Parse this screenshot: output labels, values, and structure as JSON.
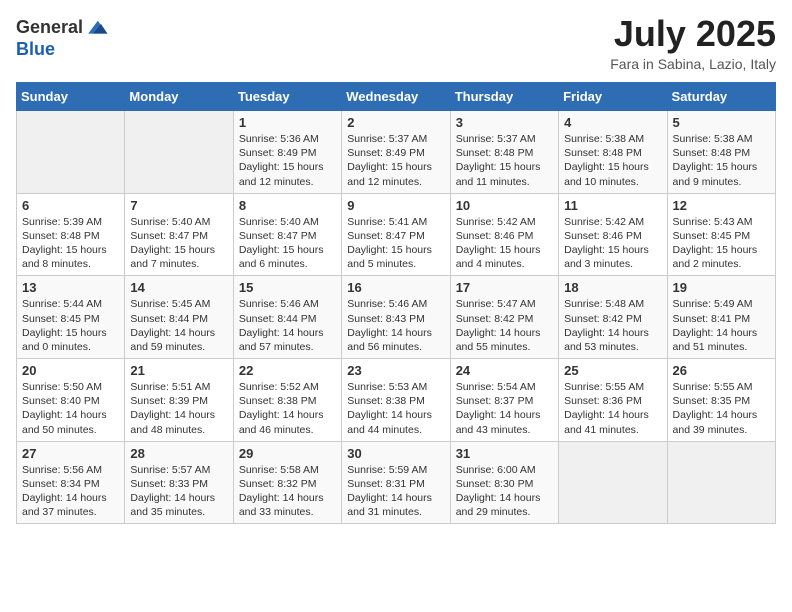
{
  "logo": {
    "general": "General",
    "blue": "Blue"
  },
  "title": "July 2025",
  "subtitle": "Fara in Sabina, Lazio, Italy",
  "days_of_week": [
    "Sunday",
    "Monday",
    "Tuesday",
    "Wednesday",
    "Thursday",
    "Friday",
    "Saturday"
  ],
  "weeks": [
    [
      {
        "day": "",
        "empty": true
      },
      {
        "day": "",
        "empty": true
      },
      {
        "day": "1",
        "sunrise": "Sunrise: 5:36 AM",
        "sunset": "Sunset: 8:49 PM",
        "daylight": "Daylight: 15 hours and 12 minutes."
      },
      {
        "day": "2",
        "sunrise": "Sunrise: 5:37 AM",
        "sunset": "Sunset: 8:49 PM",
        "daylight": "Daylight: 15 hours and 12 minutes."
      },
      {
        "day": "3",
        "sunrise": "Sunrise: 5:37 AM",
        "sunset": "Sunset: 8:48 PM",
        "daylight": "Daylight: 15 hours and 11 minutes."
      },
      {
        "day": "4",
        "sunrise": "Sunrise: 5:38 AM",
        "sunset": "Sunset: 8:48 PM",
        "daylight": "Daylight: 15 hours and 10 minutes."
      },
      {
        "day": "5",
        "sunrise": "Sunrise: 5:38 AM",
        "sunset": "Sunset: 8:48 PM",
        "daylight": "Daylight: 15 hours and 9 minutes."
      }
    ],
    [
      {
        "day": "6",
        "sunrise": "Sunrise: 5:39 AM",
        "sunset": "Sunset: 8:48 PM",
        "daylight": "Daylight: 15 hours and 8 minutes."
      },
      {
        "day": "7",
        "sunrise": "Sunrise: 5:40 AM",
        "sunset": "Sunset: 8:47 PM",
        "daylight": "Daylight: 15 hours and 7 minutes."
      },
      {
        "day": "8",
        "sunrise": "Sunrise: 5:40 AM",
        "sunset": "Sunset: 8:47 PM",
        "daylight": "Daylight: 15 hours and 6 minutes."
      },
      {
        "day": "9",
        "sunrise": "Sunrise: 5:41 AM",
        "sunset": "Sunset: 8:47 PM",
        "daylight": "Daylight: 15 hours and 5 minutes."
      },
      {
        "day": "10",
        "sunrise": "Sunrise: 5:42 AM",
        "sunset": "Sunset: 8:46 PM",
        "daylight": "Daylight: 15 hours and 4 minutes."
      },
      {
        "day": "11",
        "sunrise": "Sunrise: 5:42 AM",
        "sunset": "Sunset: 8:46 PM",
        "daylight": "Daylight: 15 hours and 3 minutes."
      },
      {
        "day": "12",
        "sunrise": "Sunrise: 5:43 AM",
        "sunset": "Sunset: 8:45 PM",
        "daylight": "Daylight: 15 hours and 2 minutes."
      }
    ],
    [
      {
        "day": "13",
        "sunrise": "Sunrise: 5:44 AM",
        "sunset": "Sunset: 8:45 PM",
        "daylight": "Daylight: 15 hours and 0 minutes."
      },
      {
        "day": "14",
        "sunrise": "Sunrise: 5:45 AM",
        "sunset": "Sunset: 8:44 PM",
        "daylight": "Daylight: 14 hours and 59 minutes."
      },
      {
        "day": "15",
        "sunrise": "Sunrise: 5:46 AM",
        "sunset": "Sunset: 8:44 PM",
        "daylight": "Daylight: 14 hours and 57 minutes."
      },
      {
        "day": "16",
        "sunrise": "Sunrise: 5:46 AM",
        "sunset": "Sunset: 8:43 PM",
        "daylight": "Daylight: 14 hours and 56 minutes."
      },
      {
        "day": "17",
        "sunrise": "Sunrise: 5:47 AM",
        "sunset": "Sunset: 8:42 PM",
        "daylight": "Daylight: 14 hours and 55 minutes."
      },
      {
        "day": "18",
        "sunrise": "Sunrise: 5:48 AM",
        "sunset": "Sunset: 8:42 PM",
        "daylight": "Daylight: 14 hours and 53 minutes."
      },
      {
        "day": "19",
        "sunrise": "Sunrise: 5:49 AM",
        "sunset": "Sunset: 8:41 PM",
        "daylight": "Daylight: 14 hours and 51 minutes."
      }
    ],
    [
      {
        "day": "20",
        "sunrise": "Sunrise: 5:50 AM",
        "sunset": "Sunset: 8:40 PM",
        "daylight": "Daylight: 14 hours and 50 minutes."
      },
      {
        "day": "21",
        "sunrise": "Sunrise: 5:51 AM",
        "sunset": "Sunset: 8:39 PM",
        "daylight": "Daylight: 14 hours and 48 minutes."
      },
      {
        "day": "22",
        "sunrise": "Sunrise: 5:52 AM",
        "sunset": "Sunset: 8:38 PM",
        "daylight": "Daylight: 14 hours and 46 minutes."
      },
      {
        "day": "23",
        "sunrise": "Sunrise: 5:53 AM",
        "sunset": "Sunset: 8:38 PM",
        "daylight": "Daylight: 14 hours and 44 minutes."
      },
      {
        "day": "24",
        "sunrise": "Sunrise: 5:54 AM",
        "sunset": "Sunset: 8:37 PM",
        "daylight": "Daylight: 14 hours and 43 minutes."
      },
      {
        "day": "25",
        "sunrise": "Sunrise: 5:55 AM",
        "sunset": "Sunset: 8:36 PM",
        "daylight": "Daylight: 14 hours and 41 minutes."
      },
      {
        "day": "26",
        "sunrise": "Sunrise: 5:55 AM",
        "sunset": "Sunset: 8:35 PM",
        "daylight": "Daylight: 14 hours and 39 minutes."
      }
    ],
    [
      {
        "day": "27",
        "sunrise": "Sunrise: 5:56 AM",
        "sunset": "Sunset: 8:34 PM",
        "daylight": "Daylight: 14 hours and 37 minutes."
      },
      {
        "day": "28",
        "sunrise": "Sunrise: 5:57 AM",
        "sunset": "Sunset: 8:33 PM",
        "daylight": "Daylight: 14 hours and 35 minutes."
      },
      {
        "day": "29",
        "sunrise": "Sunrise: 5:58 AM",
        "sunset": "Sunset: 8:32 PM",
        "daylight": "Daylight: 14 hours and 33 minutes."
      },
      {
        "day": "30",
        "sunrise": "Sunrise: 5:59 AM",
        "sunset": "Sunset: 8:31 PM",
        "daylight": "Daylight: 14 hours and 31 minutes."
      },
      {
        "day": "31",
        "sunrise": "Sunrise: 6:00 AM",
        "sunset": "Sunset: 8:30 PM",
        "daylight": "Daylight: 14 hours and 29 minutes."
      },
      {
        "day": "",
        "empty": true
      },
      {
        "day": "",
        "empty": true
      }
    ]
  ]
}
